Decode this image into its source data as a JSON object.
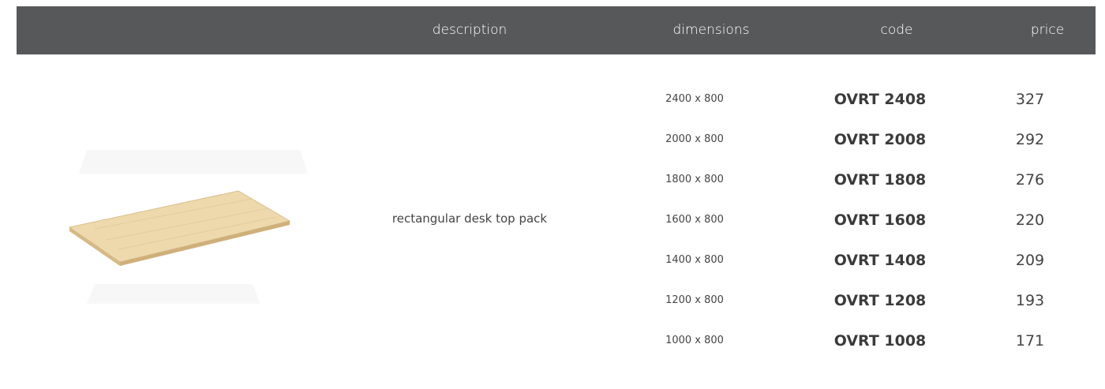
{
  "header": {
    "description": "description",
    "dimensions": "dimensions",
    "code": "code",
    "price": "price"
  },
  "product": {
    "description": "rectangular desk top pack",
    "image": "rectangular-desk-top-image"
  },
  "rows": [
    {
      "dimensions": "2400 x 800",
      "code": "OVRT 2408",
      "price": "327"
    },
    {
      "dimensions": "2000 x 800",
      "code": "OVRT 2008",
      "price": "292"
    },
    {
      "dimensions": "1800 x 800",
      "code": "OVRT 1808",
      "price": "276"
    },
    {
      "dimensions": "1600 x 800",
      "code": "OVRT 1608",
      "price": "220"
    },
    {
      "dimensions": "1400 x 800",
      "code": "OVRT 1408",
      "price": "209"
    },
    {
      "dimensions": "1200 x 800",
      "code": "OVRT 1208",
      "price": "193"
    },
    {
      "dimensions": "1000 x 800",
      "code": "OVRT 1008",
      "price": "171"
    }
  ],
  "colors": {
    "header_background": "#57585a",
    "header_text": "#ffffff",
    "body_text": "#3a3a3a",
    "desk_top": "#eed9ad"
  }
}
